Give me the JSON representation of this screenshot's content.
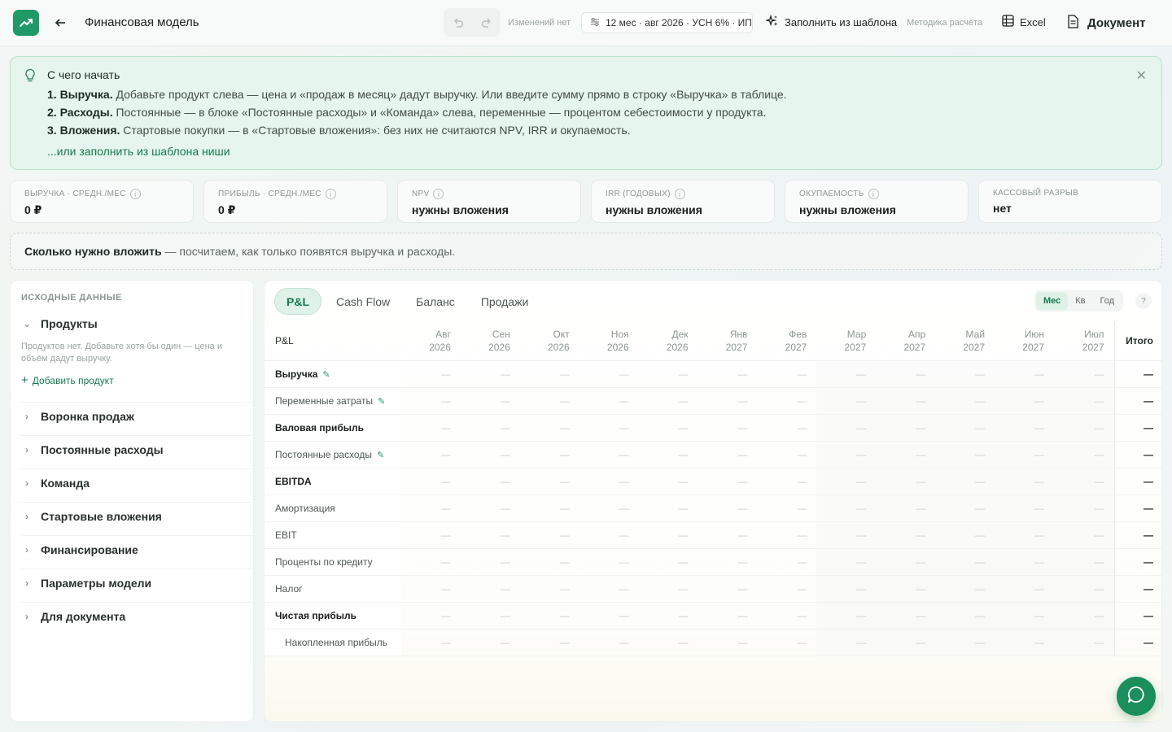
{
  "header": {
    "title": "Финансовая модель",
    "changes": "Изменений нет",
    "period": "12 мес · авг 2026 · УСН 6% · ИП",
    "fill_template": "Заполнить из шаблона",
    "methodology": "Методика расчёта",
    "excel": "Excel",
    "document": "Документ"
  },
  "hint": {
    "title": "С чего начать",
    "line1_bold": "1. Выручка.",
    "line1_text": " Добавьте продукт слева — цена и «продаж в месяц» дадут выручку. Или введите сумму прямо в строку «Выручка» в таблице.",
    "line2_bold": "2. Расходы.",
    "line2_text": " Постоянные — в блоке «Постоянные расходы» и «Команда» слева, переменные — процентом себестоимости у продукта.",
    "line3_bold": "3. Вложения.",
    "line3_text": " Стартовые покупки — в «Стартовые вложения»: без них не считаются NPV, IRR и окупаемость.",
    "link": "...или заполнить из шаблона ниши"
  },
  "kpis": [
    {
      "label": "ВЫРУЧКА · СРЕДН./МЕС",
      "value": "0 ₽",
      "info": true
    },
    {
      "label": "ПРИБЫЛЬ · СРЕДН./МЕС",
      "value": "0 ₽",
      "info": true
    },
    {
      "label": "NPV",
      "value": "нужны вложения",
      "info": true
    },
    {
      "label": "IRR (ГОДОВЫХ)",
      "value": "нужны вложения",
      "info": true
    },
    {
      "label": "ОКУПАЕМОСТЬ",
      "value": "нужны вложения",
      "info": true
    },
    {
      "label": "КАССОВЫЙ РАЗРЫВ",
      "value": "нет",
      "info": false
    }
  ],
  "invest": {
    "bold": "Сколько нужно вложить",
    "text": " — посчитаем, как только появятся выручка и расходы."
  },
  "left": {
    "header": "ИСХОДНЫЕ ДАННЫЕ",
    "products": "Продукты",
    "empty": "Продуктов нет. Добавьте хотя бы один — цена и объём дадут выручку.",
    "add_product": "Добавить продукт",
    "sections": [
      "Воронка продаж",
      "Постоянные расходы",
      "Команда",
      "Стартовые вложения",
      "Финансирование",
      "Параметры модели",
      "Для документа"
    ]
  },
  "table": {
    "tabs": [
      "P&L",
      "Cash Flow",
      "Баланс",
      "Продажи"
    ],
    "periods": [
      "Мес",
      "Кв",
      "Год"
    ],
    "help": "?",
    "corner": "P&L",
    "total": "Итого",
    "months": [
      {
        "m": "Авг",
        "y": "2026"
      },
      {
        "m": "Сен",
        "y": "2026"
      },
      {
        "m": "Окт",
        "y": "2026"
      },
      {
        "m": "Ноя",
        "y": "2026"
      },
      {
        "m": "Дек",
        "y": "2026"
      },
      {
        "m": "Янв",
        "y": "2027"
      },
      {
        "m": "Фев",
        "y": "2027"
      },
      {
        "m": "Мар",
        "y": "2027"
      },
      {
        "m": "Апр",
        "y": "2027"
      },
      {
        "m": "Май",
        "y": "2027"
      },
      {
        "m": "Июн",
        "y": "2027"
      },
      {
        "m": "Июл",
        "y": "2027"
      }
    ],
    "empty_cell": "—",
    "rows": [
      {
        "label": "Выручка",
        "bold": true,
        "editable": true
      },
      {
        "label": "Переменные затраты",
        "bold": false,
        "editable": true
      },
      {
        "label": "Валовая прибыль",
        "bold": true,
        "editable": false
      },
      {
        "label": "Постоянные расходы",
        "bold": false,
        "editable": true
      },
      {
        "label": "EBITDA",
        "bold": true,
        "editable": false
      },
      {
        "label": "Амортизация",
        "bold": false,
        "editable": false
      },
      {
        "label": "EBIT",
        "bold": false,
        "editable": false
      },
      {
        "label": "Проценты по кредиту",
        "bold": false,
        "editable": false
      },
      {
        "label": "Налог",
        "bold": false,
        "editable": false
      },
      {
        "label": "Чистая прибыль",
        "bold": true,
        "editable": false
      },
      {
        "label": "Накопленная прибыль",
        "bold": false,
        "editable": false,
        "sub": true
      }
    ]
  },
  "colors": {
    "accent": "#1f9a66",
    "accent_text": "#157a50",
    "hint_bg": "#e6f5ee"
  }
}
